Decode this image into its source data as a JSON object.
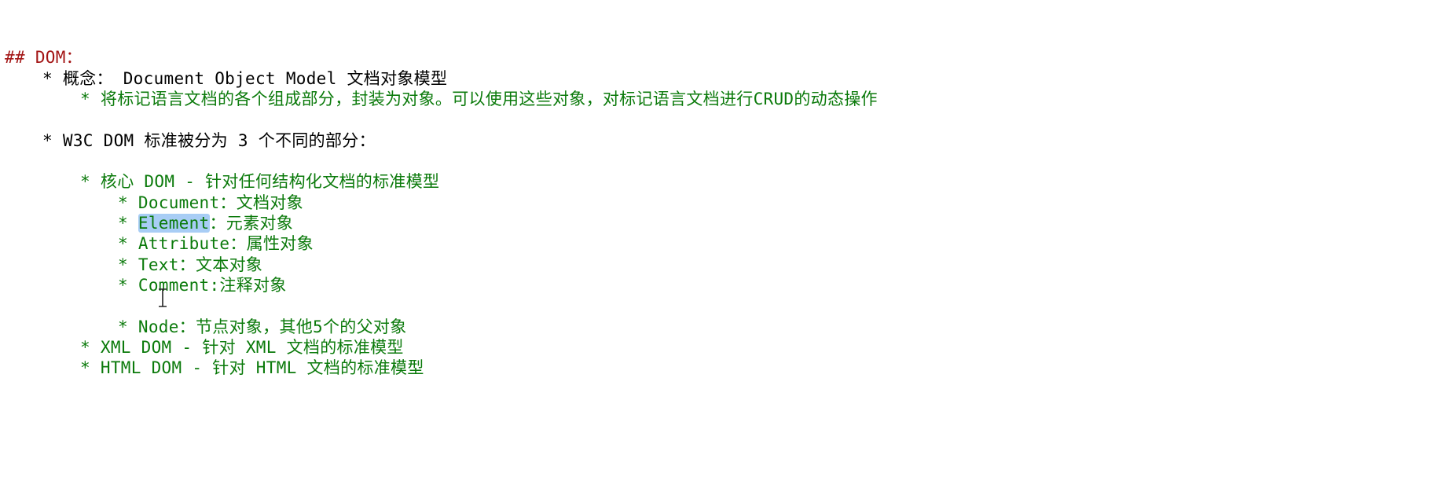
{
  "editor": {
    "lines": [
      {
        "id": "h",
        "prefix": "## ",
        "text": "DOM："
      },
      {
        "id": "l1",
        "text": "概念： Document Object Model 文档对象模型"
      },
      {
        "id": "l2",
        "text": "将标记语言文档的各个组成部分，封装为对象。可以使用这些对象，对标记语言文档进行CRUD的动态操作"
      },
      {
        "id": "l3",
        "text": "W3C DOM 标准被分为 3 个不同的部分："
      },
      {
        "id": "l4",
        "text": "核心 DOM - 针对任何结构化文档的标准模型"
      },
      {
        "id": "l5",
        "text": "Document：文档对象"
      },
      {
        "id": "l6_sel",
        "text": "Element"
      },
      {
        "id": "l6_rest",
        "text": "：元素对象"
      },
      {
        "id": "l7",
        "text": "Attribute：属性对象"
      },
      {
        "id": "l8",
        "text": "Text：文本对象"
      },
      {
        "id": "l9",
        "text": "Comment:注释对象"
      },
      {
        "id": "l10",
        "text": "Node：节点对象，其他5个的父对象"
      },
      {
        "id": "l11",
        "text": "XML DOM - 针对 XML 文档的标准模型"
      },
      {
        "id": "l12",
        "text": "HTML DOM - 针对 HTML 文档的标准模型"
      }
    ],
    "bullet": "* ",
    "heading_color": "#a31515",
    "text_color": "#0b7a0b",
    "selection_color": "#a8cdf5"
  }
}
